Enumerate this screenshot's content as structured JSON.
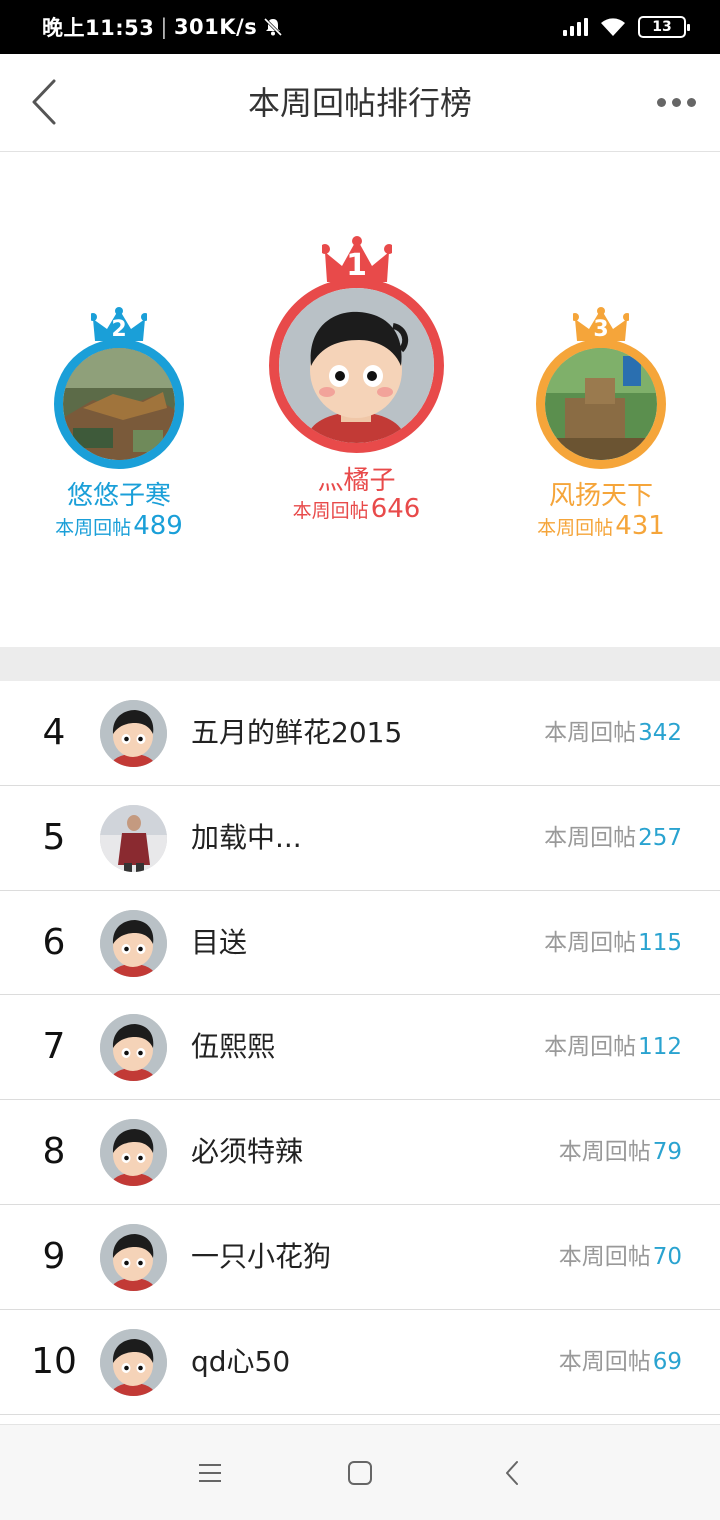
{
  "status_bar": {
    "time": "晚上11:53",
    "speed": "301K/s",
    "battery": "13"
  },
  "header": {
    "title": "本周回帖排行榜"
  },
  "podium": [
    {
      "rank": "2",
      "name": "悠悠子寒",
      "label": "本周回帖",
      "count": "489",
      "color": "#1a9fd8"
    },
    {
      "rank": "1",
      "name": "灬橘子",
      "label": "本周回帖",
      "count": "646",
      "color": "#e84a4a"
    },
    {
      "rank": "3",
      "name": "风扬天下",
      "label": "本周回帖",
      "count": "431",
      "color": "#f5a53a"
    }
  ],
  "list": [
    {
      "rank": "4",
      "name": "五月的鲜花2015",
      "label": "本周回帖",
      "count": "342"
    },
    {
      "rank": "5",
      "name": "加载中...",
      "label": "本周回帖",
      "count": "257"
    },
    {
      "rank": "6",
      "name": "目送",
      "label": "本周回帖",
      "count": "115"
    },
    {
      "rank": "7",
      "name": "伍熙熙",
      "label": "本周回帖",
      "count": "112"
    },
    {
      "rank": "8",
      "name": "必须特辣",
      "label": "本周回帖",
      "count": "79"
    },
    {
      "rank": "9",
      "name": "一只小花狗",
      "label": "本周回帖",
      "count": "70"
    },
    {
      "rank": "10",
      "name": "qd心50",
      "label": "本周回帖",
      "count": "69"
    }
  ],
  "icons": {
    "back": "back-arrow-icon",
    "more": "more-dots-icon",
    "nav_menu": "menu-icon",
    "nav_home": "home-icon",
    "nav_back": "nav-back-icon"
  }
}
